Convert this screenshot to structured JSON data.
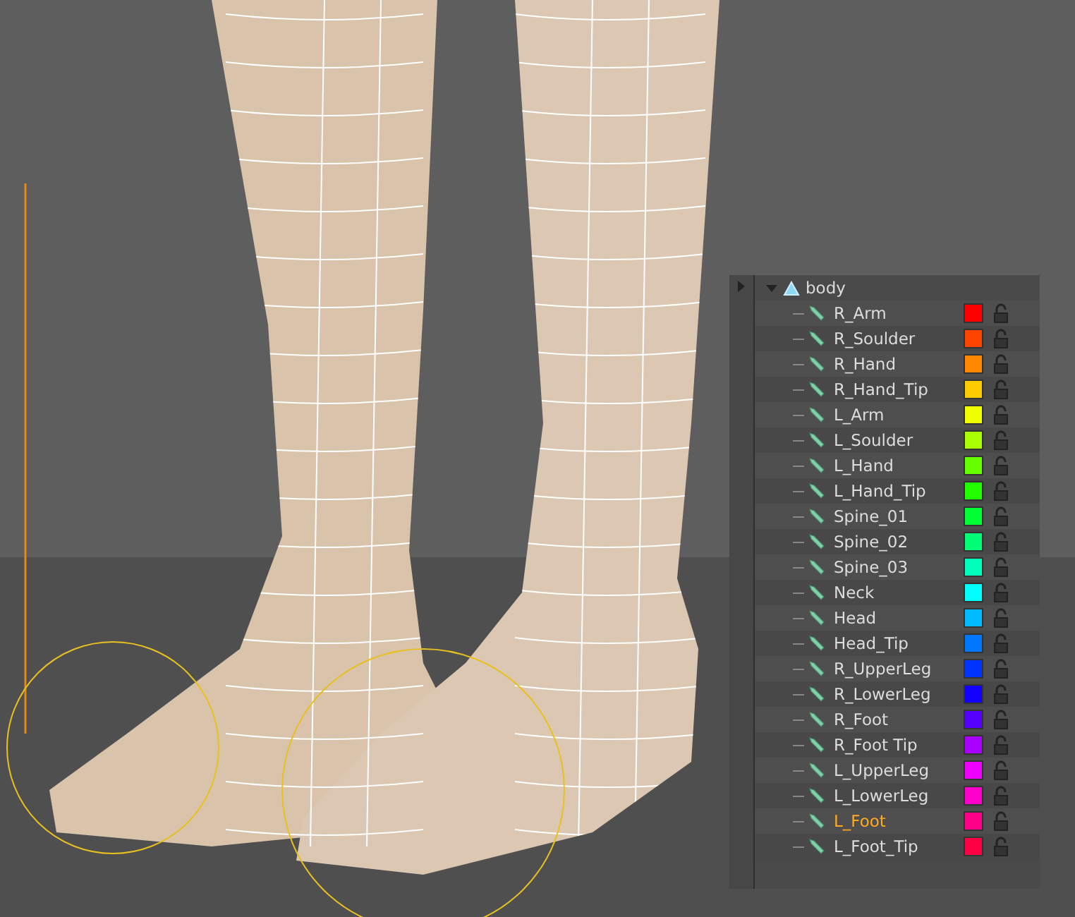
{
  "outliner": {
    "root": {
      "name": "body",
      "expanded": true
    },
    "bones": [
      {
        "name": "R_Arm",
        "color": "#ff0000",
        "selected": false,
        "locked": false
      },
      {
        "name": "R_Soulder",
        "color": "#ff4400",
        "selected": false,
        "locked": false
      },
      {
        "name": "R_Hand",
        "color": "#ff8800",
        "selected": false,
        "locked": false
      },
      {
        "name": "R_Hand_Tip",
        "color": "#ffcc00",
        "selected": false,
        "locked": false
      },
      {
        "name": "L_Arm",
        "color": "#eeff00",
        "selected": false,
        "locked": false
      },
      {
        "name": "L_Soulder",
        "color": "#aaff00",
        "selected": false,
        "locked": false
      },
      {
        "name": "L_Hand",
        "color": "#66ff00",
        "selected": false,
        "locked": false
      },
      {
        "name": "L_Hand_Tip",
        "color": "#22ff00",
        "selected": false,
        "locked": false
      },
      {
        "name": "Spine_01",
        "color": "#00ff33",
        "selected": false,
        "locked": false
      },
      {
        "name": "Spine_02",
        "color": "#00ff77",
        "selected": false,
        "locked": false
      },
      {
        "name": "Spine_03",
        "color": "#00ffbb",
        "selected": false,
        "locked": false
      },
      {
        "name": "Neck",
        "color": "#00ffff",
        "selected": false,
        "locked": false
      },
      {
        "name": "Head",
        "color": "#00bbff",
        "selected": false,
        "locked": false
      },
      {
        "name": "Head_Tip",
        "color": "#0077ff",
        "selected": false,
        "locked": false
      },
      {
        "name": "R_UpperLeg",
        "color": "#0033ff",
        "selected": false,
        "locked": false
      },
      {
        "name": "R_LowerLeg",
        "color": "#1100ff",
        "selected": false,
        "locked": false
      },
      {
        "name": "R_Foot",
        "color": "#5500ff",
        "selected": false,
        "locked": false
      },
      {
        "name": "R_Foot Tip",
        "color": "#aa00ff",
        "selected": false,
        "locked": false
      },
      {
        "name": "L_UpperLeg",
        "color": "#ee00ff",
        "selected": false,
        "locked": false
      },
      {
        "name": "L_LowerLeg",
        "color": "#ff00cc",
        "selected": false,
        "locked": false
      },
      {
        "name": "L_Foot",
        "color": "#ff0088",
        "selected": true,
        "locked": false
      },
      {
        "name": "L_Foot_Tip",
        "color": "#ff0044",
        "selected": false,
        "locked": false
      }
    ]
  }
}
